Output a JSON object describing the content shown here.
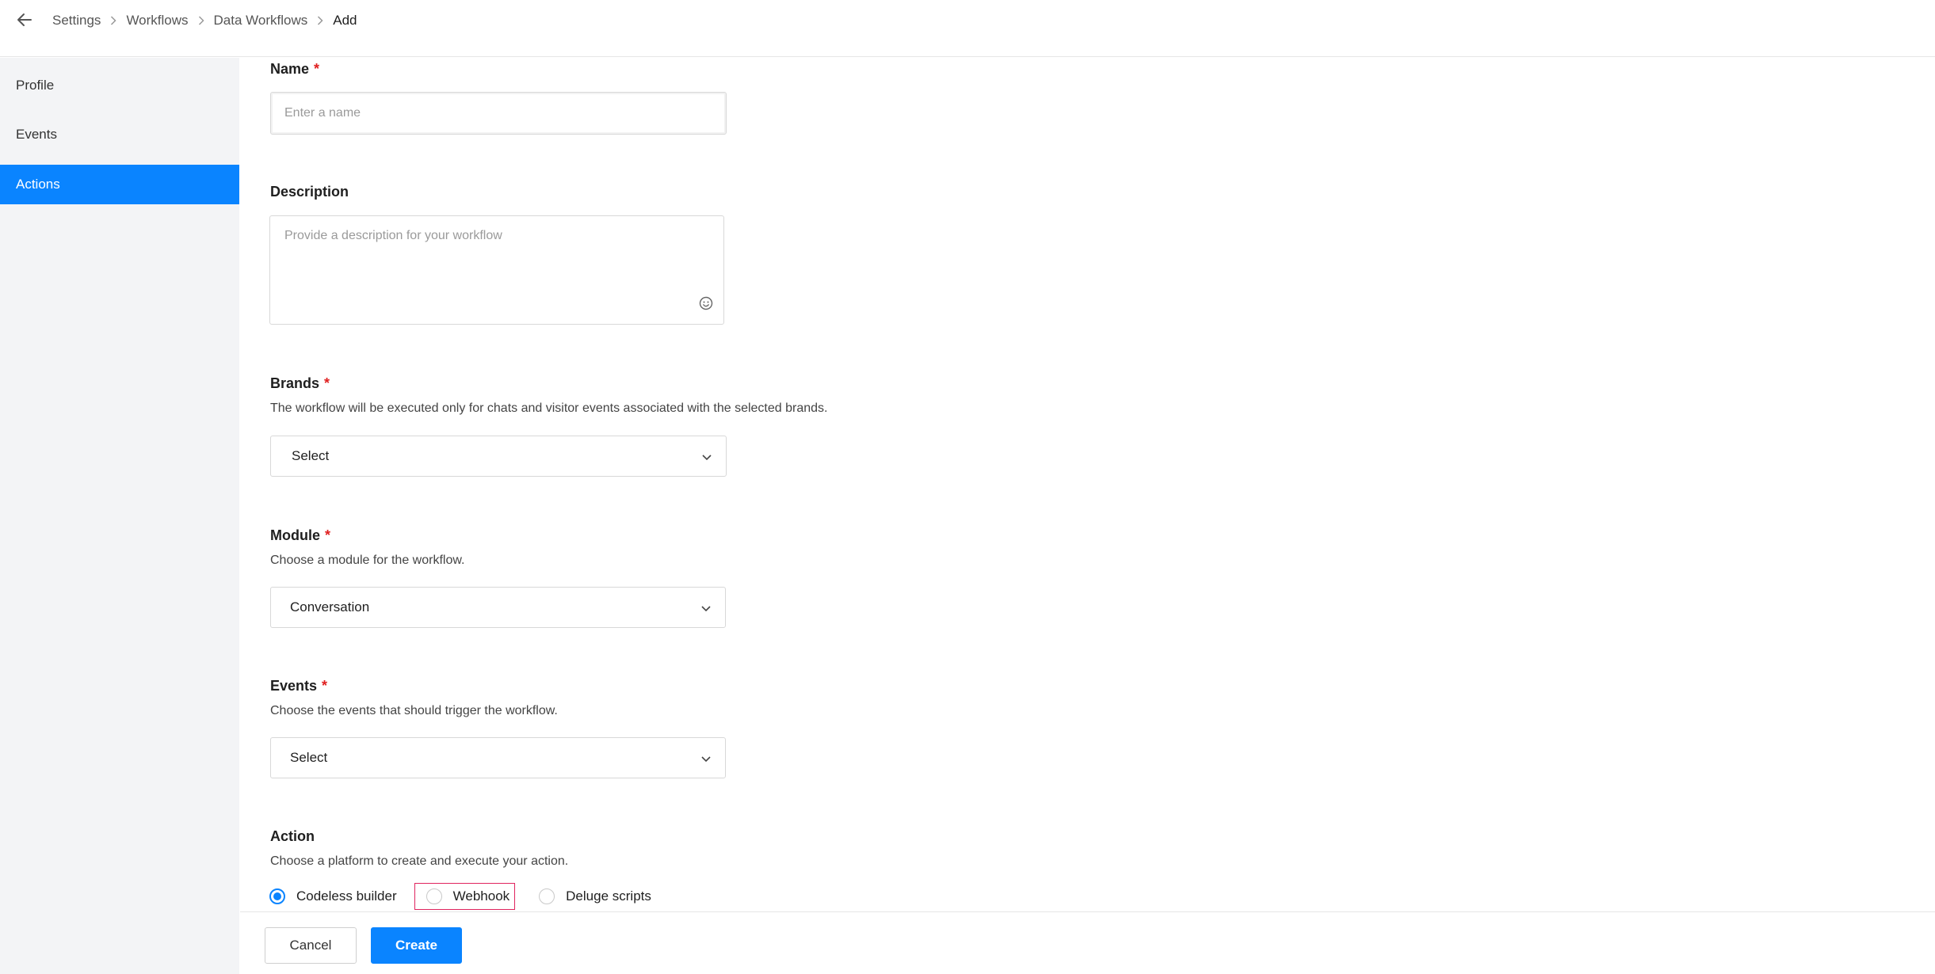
{
  "breadcrumb": {
    "items": [
      "Settings",
      "Workflows",
      "Data Workflows",
      "Add"
    ]
  },
  "icons": {
    "back": "arrow-left-icon",
    "separator": "chevron-right-icon",
    "dropdown": "chevron-down-icon",
    "emoji": "smiley-icon"
  },
  "sidebar": {
    "items": [
      {
        "label": "Profile",
        "active": false
      },
      {
        "label": "Events",
        "active": false
      },
      {
        "label": "Actions",
        "active": true
      }
    ]
  },
  "form": {
    "name": {
      "label": "Name",
      "required_mark": "*",
      "value": "",
      "placeholder": "Enter a name"
    },
    "description": {
      "label": "Description",
      "value": "",
      "placeholder": "Provide a description for your workflow"
    },
    "brands": {
      "label": "Brands",
      "required_mark": "*",
      "helper": "The workflow will be executed only for chats and visitor events associated with the selected brands.",
      "selected": "Select"
    },
    "module": {
      "label": "Module",
      "required_mark": "*",
      "helper": "Choose a module for the workflow.",
      "selected": "Conversation"
    },
    "events": {
      "label": "Events",
      "required_mark": "*",
      "helper": "Choose the events that should trigger the workflow.",
      "selected": "Select"
    },
    "action": {
      "label": "Action",
      "helper": "Choose a platform to create and execute your action.",
      "options": [
        {
          "label": "Codeless builder",
          "checked": true
        },
        {
          "label": "Webhook",
          "checked": false
        },
        {
          "label": "Deluge scripts",
          "checked": false
        }
      ]
    }
  },
  "footer": {
    "cancel_label": "Cancel",
    "create_label": "Create"
  },
  "colors": {
    "accent": "#0a84ff",
    "required": "#e02020",
    "highlight_border": "#e0245e",
    "sidebar_bg": "#f3f4f6"
  }
}
